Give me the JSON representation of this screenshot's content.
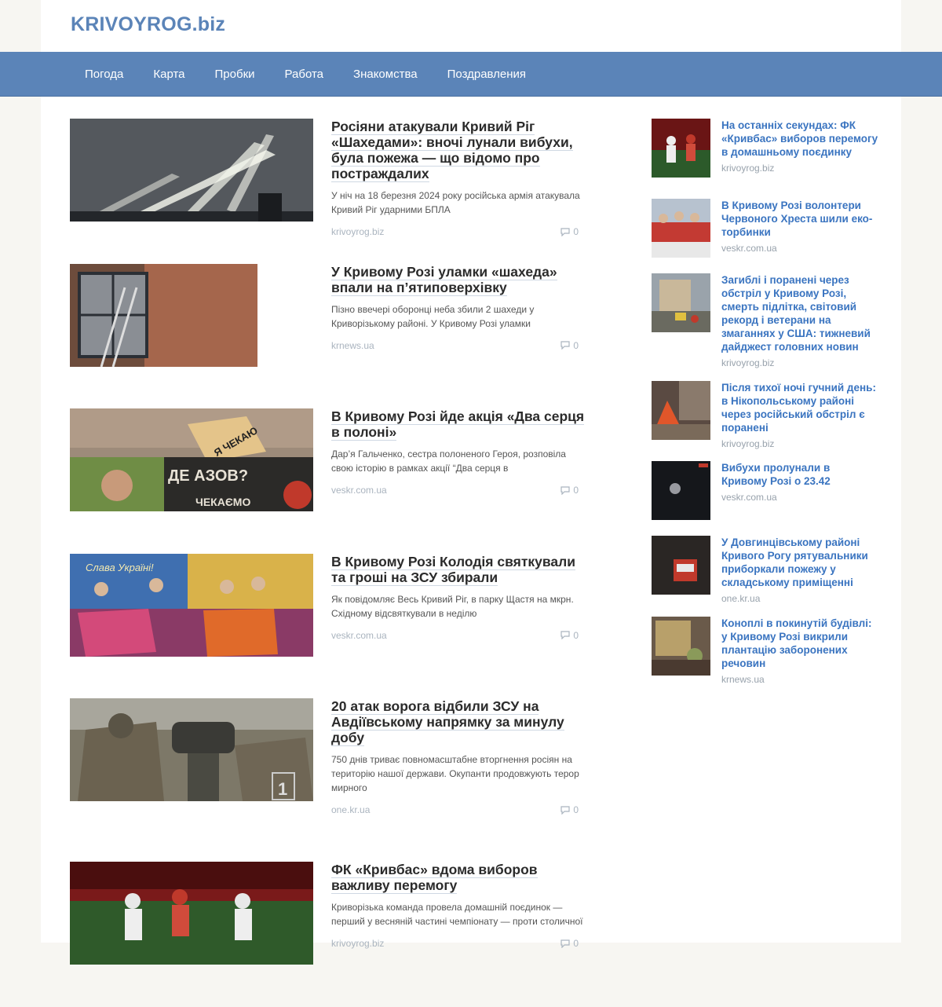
{
  "site": {
    "logo": "KRIVOYROG.biz"
  },
  "nav": [
    "Погода",
    "Карта",
    "Пробки",
    "Работа",
    "Знакомства",
    "Поздравления"
  ],
  "articles": [
    {
      "title": "Росіяни атакували Кривий Ріг «Шахедами»: вночі лунали вибухи, була пожежа — що відомо про постраждалих",
      "excerpt": "У ніч на 18 березня 2024 року російська армія атакувала Кривий Ріг ударними БПЛА",
      "source": "krivoyrog.biz",
      "comments": "0",
      "image": "searchlights-night-photo"
    },
    {
      "title": "У Кривому Розі уламки «шахеда» впали на п’ятиповерхівку",
      "excerpt": "Пізно ввечері оборонці неба збили 2 шахеди у Криворізькому районі. У Кривому Розі уламки",
      "source": "krnews.ua",
      "comments": "0",
      "image": "broken-window-photo"
    },
    {
      "title": "В Кривому Розі йде акція «Два серця в полоні»",
      "excerpt": "Дар’я Гальченко, сестра полоненого Героя, розповіла свою історію в рамках акції “Два серця в",
      "source": "veskr.com.ua",
      "comments": "0",
      "image": "azov-banner-photo",
      "image_texts": [
        "ДЕ АЗОВ?",
        "ЧЕКАЄМО",
        "Я ЧЕКАЮ"
      ]
    },
    {
      "title": "В Кривому Розі Колодія святкували та гроші на ЗСУ збирали",
      "excerpt": "Як повідомляє Весь Кривий Ріг, в парку Щастя на мкрн. Східному відсвяткували в неділю",
      "source": "veskr.com.ua",
      "comments": "0",
      "image": "festival-shawls-photo",
      "image_texts": [
        "Слава Україні!"
      ]
    },
    {
      "title": "20 атак ворога відбили ЗСУ на Авдіївському напрямку за минулу добу",
      "excerpt": "750 днів триває повномасштабне вторгнення росіян на територію нашої держави. Окупанти продовжують терор мирного",
      "source": "one.kr.ua",
      "comments": "0",
      "image": "soldiers-mortar-photo",
      "image_texts": [
        "1"
      ]
    },
    {
      "title": "ФК «Кривбас» вдома виборов важливу перемогу",
      "excerpt": "Криворізька команда провела домашній поєдинок — перший у весняній частині чемпіонату — проти столичної",
      "source": "krivoyrog.biz",
      "comments": "0",
      "image": "football-match-photo"
    }
  ],
  "sidebar": [
    {
      "title": "На останніх секундах: ФК «Кривбас» виборов перемогу в домашньому поєдинку",
      "source": "krivoyrog.biz",
      "image": "football-photo"
    },
    {
      "title": "В Кривому Розі волонтери Червоного Хреста шили еко-торбинки",
      "source": "veskr.com.ua",
      "image": "red-cross-volunteers-photo"
    },
    {
      "title": "Загиблі і поранені через обстріл у Кривому Розі, смерть підлітка, світовий рекорд і ветерани на змаганнях у США: тижневий дайджест головних новин",
      "source": "krivoyrog.biz",
      "image": "damaged-building-photo"
    },
    {
      "title": "Після тихої ночі гучний день: в Нікопольському районі через російський обстріл є поранені",
      "source": "krivoyrog.biz",
      "image": "fire-ruins-photo"
    },
    {
      "title": "Вибухи пролунали в Кривому Розі о 23.42",
      "source": "veskr.com.ua",
      "image": "night-sky-photo"
    },
    {
      "title": "У Довгинцівському районі Кривого Рогу рятувальники приборкали пожежу у складському приміщенні",
      "source": "one.kr.ua",
      "image": "warehouse-fire-photo"
    },
    {
      "title": "Коноплі в покинутій будівлі: у Кривому Розі викрили плантацію заборонених речовин",
      "source": "krnews.ua",
      "image": "cannabis-photo"
    }
  ],
  "colors": {
    "accent": "#5b84b8",
    "link": "#3a74c0",
    "muted": "#aab4bf"
  },
  "icons": {
    "comments": "speech-bubble-icon"
  }
}
